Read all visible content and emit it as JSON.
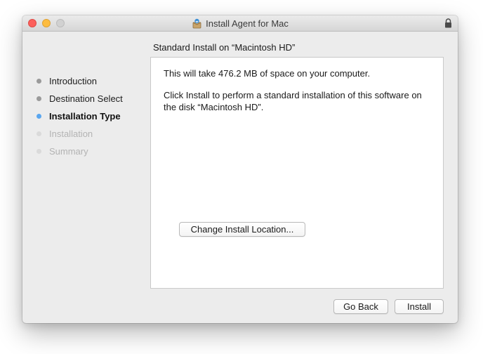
{
  "window": {
    "title": "Install Agent for Mac",
    "app_icon": "installer-app-icon",
    "lock_icon": "lock-icon"
  },
  "content": {
    "heading": "Standard Install on “Macintosh HD”",
    "space_text": "This will take 476.2 MB of space on your computer.",
    "install_text": "Click Install to perform a standard installation of this software on the disk “Macintosh HD”."
  },
  "steps": [
    {
      "label": "Introduction",
      "state": "done"
    },
    {
      "label": "Destination Select",
      "state": "done"
    },
    {
      "label": "Installation Type",
      "state": "current"
    },
    {
      "label": "Installation",
      "state": "pending"
    },
    {
      "label": "Summary",
      "state": "pending"
    }
  ],
  "buttons": {
    "change_location": "Change Install Location...",
    "go_back": "Go Back",
    "install": "Install"
  },
  "colors": {
    "current_step_dot": "#5aa6ef",
    "close": "#fc605c",
    "minimize": "#fdbc40",
    "maximize": "#d1d1d1"
  }
}
